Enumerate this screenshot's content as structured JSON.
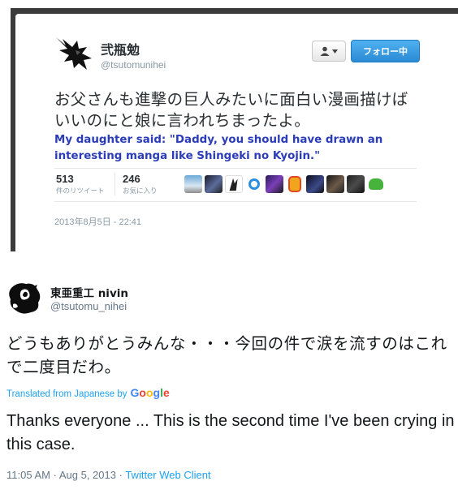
{
  "embedded_tweet": {
    "display_name": "弐瓶勉",
    "handle": "@tsutomunihei",
    "follow_label": "フォロー中",
    "text_jp": "お父さんも進撃の巨人みたいに面白い漫画描けばいいのにと娘に言われちまったよ。",
    "text_en": "My daughter said: \"Daddy, you should have drawn an interesting manga like Shingeki no Kyojin.\"",
    "retweets_count": "513",
    "retweets_label": "件のリツイート",
    "favorites_count": "246",
    "favorites_label": "お気に入り",
    "date": "2013年8月5日 - 22:41",
    "colors": {
      "follow_button": "#2a8ad4",
      "english_text": "#2a3cb8"
    }
  },
  "tweet": {
    "display_name": "東亜重工 nivin",
    "handle": "@tsutomu_nihei",
    "text_jp": "どうもありがとうみんな・・・今回の件で涙を流すのはこれで二度目だわ。",
    "translated_prefix": "Translated from Japanese by",
    "translator": "Google",
    "text_en": "Thanks everyone ... This is the second time I've been crying in this case.",
    "time": "11:05 AM",
    "date": "Aug 5, 2013",
    "client": "Twitter Web Client",
    "separator": "·",
    "colors": {
      "link": "#1da1f2",
      "meta": "#657786"
    }
  }
}
